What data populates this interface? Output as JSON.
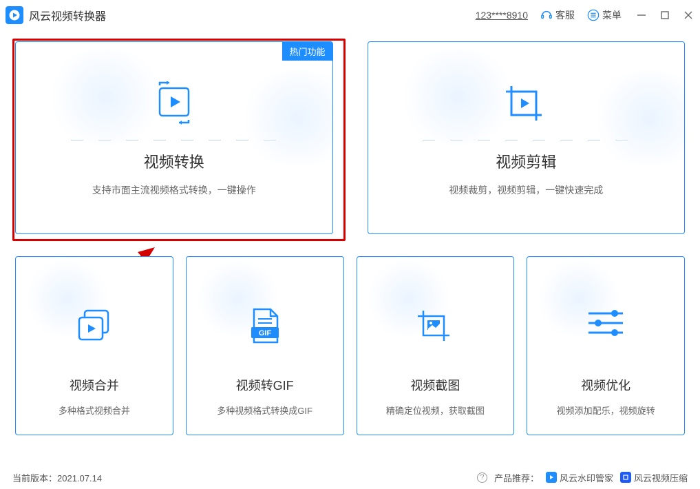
{
  "app": {
    "title": "风云视频转换器"
  },
  "titlebar": {
    "account_id": "123****8910",
    "support_label": "客服",
    "menu_label": "菜单"
  },
  "cards": {
    "convert": {
      "title": "视频转换",
      "desc": "支持市面主流视频格式转换，一键操作",
      "hot_badge": "热门功能"
    },
    "edit": {
      "title": "视频剪辑",
      "desc": "视频裁剪，视频剪辑，一键快速完成"
    },
    "merge": {
      "title": "视频合并",
      "desc": "多种格式视频合并"
    },
    "gif": {
      "title": "视频转GIF",
      "desc": "多种视频格式转换成GIF",
      "gif_badge": "GIF"
    },
    "screenshot": {
      "title": "视频截图",
      "desc": "精确定位视频，获取截图"
    },
    "optimize": {
      "title": "视频优化",
      "desc": "视频添加配乐，视频旋转"
    }
  },
  "statusbar": {
    "version_prefix": "当前版本：",
    "version": "2021.07.14",
    "recommend_label": "产品推荐：",
    "link1": "风云水印管家",
    "link2": "风云视频压缩"
  }
}
